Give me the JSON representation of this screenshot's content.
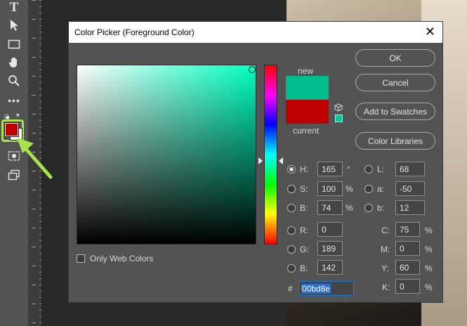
{
  "dialog": {
    "title": "Color Picker (Foreground Color)",
    "close_label": "✕"
  },
  "preview": {
    "new_label": "new",
    "current_label": "current",
    "new_color": "#00bd8e",
    "current_color": "#bd0000"
  },
  "buttons": {
    "ok": "OK",
    "cancel": "Cancel",
    "add_to_swatches": "Add to Swatches",
    "color_libraries": "Color Libraries"
  },
  "only_web_colors": "Only Web Colors",
  "hsb": {
    "h_label": "H:",
    "h_value": "165",
    "h_unit": "°",
    "s_label": "S:",
    "s_value": "100",
    "s_unit": "%",
    "b_label": "B:",
    "b_value": "74",
    "b_unit": "%"
  },
  "lab": {
    "l_label": "L:",
    "l_value": "68",
    "a_label": "a:",
    "a_value": "-50",
    "b_label": "b:",
    "b_value": "12"
  },
  "rgb": {
    "r_label": "R:",
    "r_value": "0",
    "g_label": "G:",
    "g_value": "189",
    "b_label": "B:",
    "b_value": "142"
  },
  "cmyk": {
    "c_label": "C:",
    "c_value": "75",
    "m_label": "M:",
    "m_value": "0",
    "y_label": "Y:",
    "y_value": "60",
    "k_label": "K:",
    "k_value": "0",
    "unit": "%"
  },
  "hex": {
    "label": "#",
    "value": "00bd8e"
  },
  "toolbar": {
    "type_tool_glyph": "T",
    "foreground_color": "#bd0000",
    "background_color": "#ffffff",
    "highlight_color": "#a7e34a"
  }
}
